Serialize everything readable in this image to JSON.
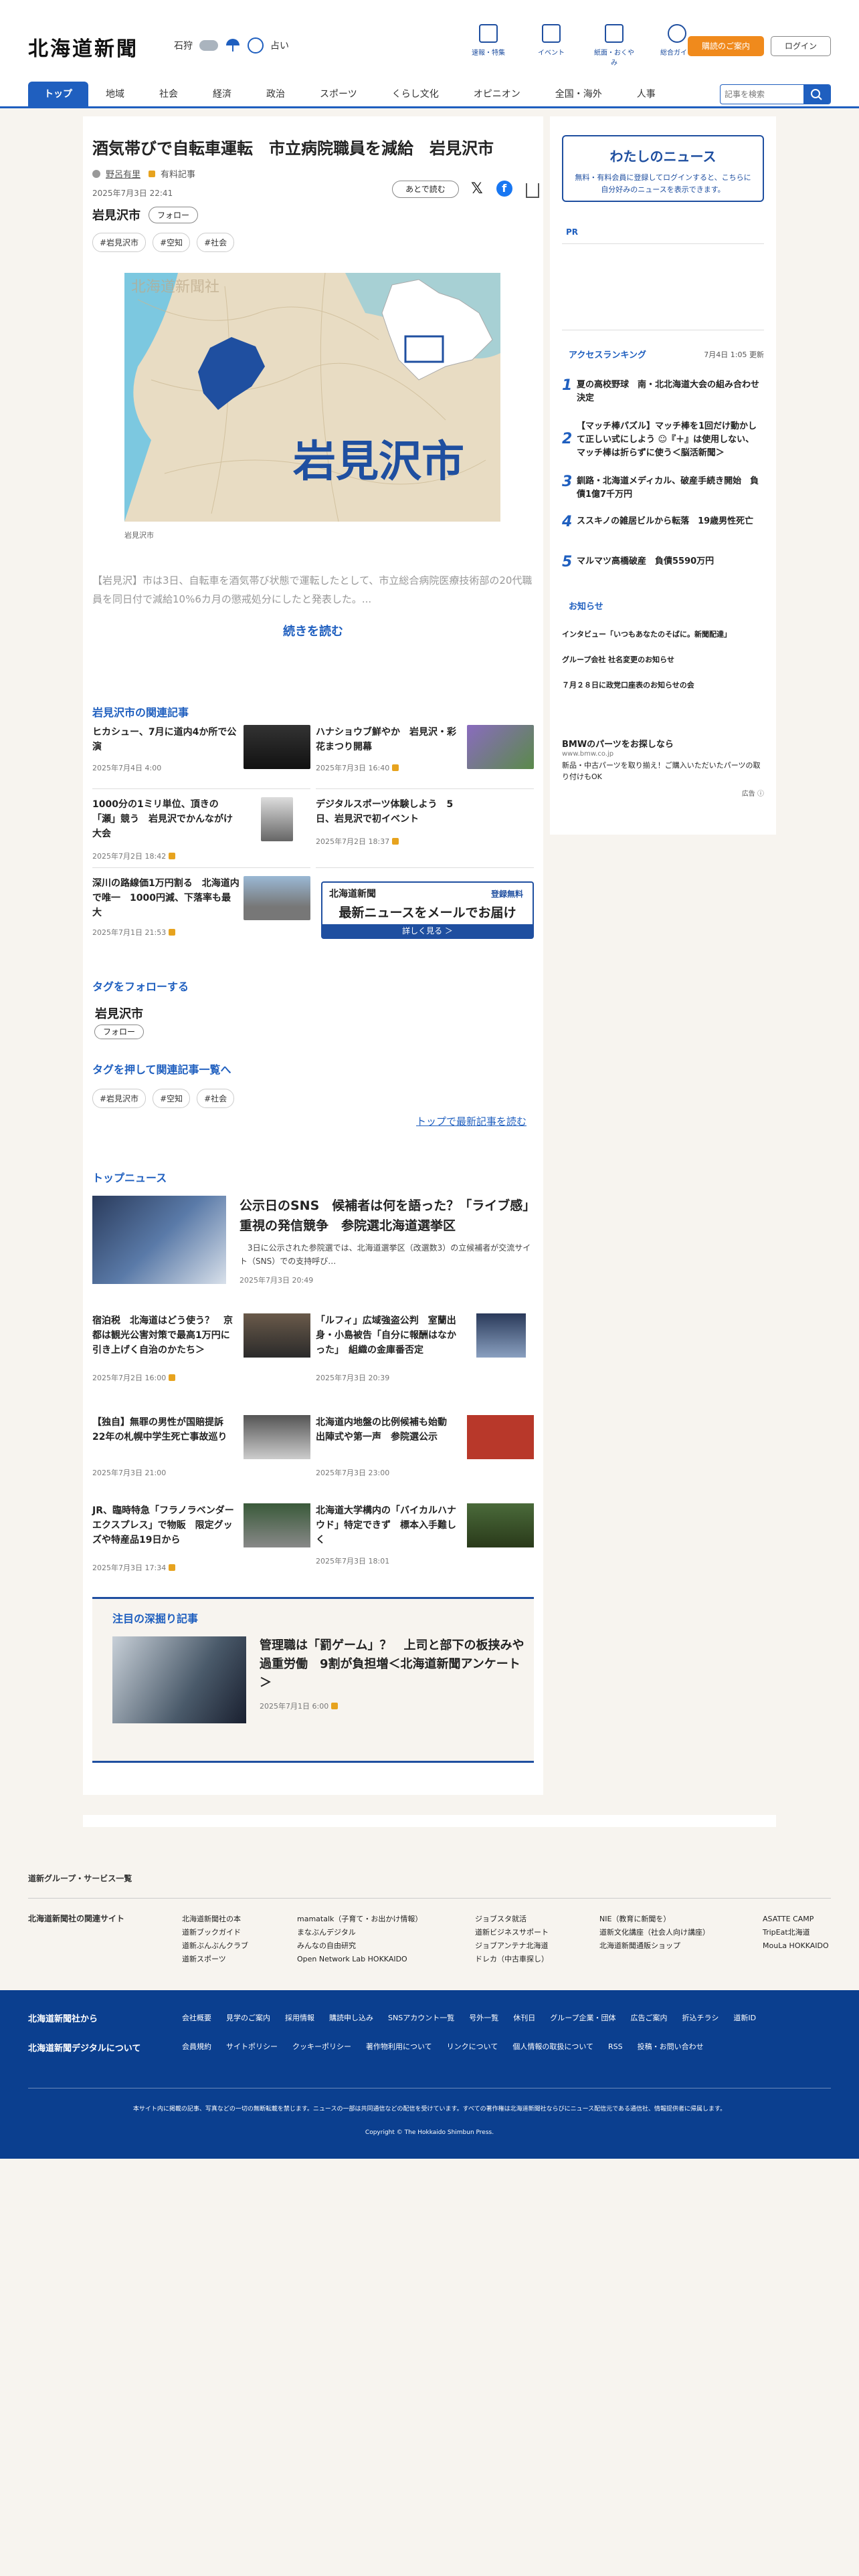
{
  "header": {
    "logo": "北海道新聞",
    "weather_city": "石狩",
    "weather_label": "占い",
    "icons": [
      {
        "label": "速報・特集",
        "icon": "flag-icon"
      },
      {
        "label": "イベント",
        "icon": "calendar-icon"
      },
      {
        "label": "紙面・おくやみ",
        "icon": "newspaper-icon"
      },
      {
        "label": "総合ガイド",
        "icon": "help-icon"
      }
    ],
    "subscribe": "購読のご案内",
    "login": "ログイン"
  },
  "nav": {
    "items": [
      "トップ",
      "地域",
      "社会",
      "経済",
      "政治",
      "スポーツ",
      "くらし文化",
      "オピニオン",
      "全国・海外",
      "人事"
    ],
    "search_placeholder": "記事を検索"
  },
  "article": {
    "title": "酒気帯びで自転車運転　市立病院職員を減給　岩見沢市",
    "author": "野呂有里",
    "paper": "有料記事",
    "date": "2025年7月3日 22:41",
    "read_later": "あとで読む",
    "tag_name": "岩見沢市",
    "follow": "フォロー",
    "tags": [
      "#岩見沢市",
      "#空知",
      "#社会"
    ],
    "image_watermark": "北海道新聞社",
    "image_city": "岩見沢市",
    "caption": "岩見沢市",
    "lead": "【岩見沢】市は3日、自転車を酒気帯び状態で運転したとして、市立総合病院医療技術部の20代職員を同日付で減給10%6カ月の懲戒処分にしたと発表した。...",
    "more": "続きを読む"
  },
  "related": {
    "heading": "岩見沢市の関連記事",
    "items": [
      {
        "title": "ヒカシュー、7月に道内4か所で公演",
        "date": "2025年7月4日 4:00",
        "lock": false
      },
      {
        "title": "ハナショウブ鮮やか　岩見沢・彩花まつり開幕",
        "date": "2025年7月3日 16:40",
        "lock": true
      },
      {
        "title": "1000分の1ミリ単位、頂きの「瀬」競う　岩見沢でかんながけ大会",
        "date": "2025年7月2日 18:42",
        "lock": true
      },
      {
        "title": "デジタルスポーツ体験しよう　5日、岩見沢で初イベント",
        "date": "2025年7月2日 18:37",
        "lock": true
      },
      {
        "title": "深川の路線価1万円割る　北海道内で唯一　1000円減、下落率も最大",
        "date": "2025年7月1日 21:53",
        "lock": true
      }
    ],
    "ad": {
      "logo": "北海道新聞",
      "badge": "登録無料",
      "main": "最新ニュースをメールでお届け",
      "sub": "詳しく見る ＞"
    }
  },
  "tagfollow": {
    "heading": "タグをフォローする",
    "tag": "岩見沢市",
    "follow": "フォロー",
    "heading2": "タグを押して関連記事一覧へ",
    "tags": [
      "#岩見沢市",
      "#空知",
      "#社会"
    ],
    "latest_link": "トップで最新記事を読む"
  },
  "top": {
    "heading": "トップニュース",
    "lead": {
      "title": "公示日のSNS　候補者は何を語った？「ライブ感」重視の発信競争　参院選北海道選挙区",
      "body": "　3日に公示された参院選では、北海道選挙区（改選数3）の立候補者が交流サイト（SNS）での支持呼び…",
      "date": "2025年7月3日 20:49"
    },
    "items": [
      {
        "title": "宿泊税　北海道はどう使う？　京都は観光公害対策で最高1万円に引き上げく自治のかたち＞",
        "date": "2025年7月2日 16:00",
        "lock": true
      },
      {
        "title": "「ルフィ」広域強盗公判　室蘭出身・小島被告「自分に報酬はなかった」　組織の金庫番否定",
        "date": "2025年7月3日 20:39",
        "lock": false
      },
      {
        "title": "【独自】無罪の男性が国賠提訴　22年の札幌中学生死亡事故巡り",
        "date": "2025年7月3日 21:00",
        "lock": false
      },
      {
        "title": "北海道内地盤の比例候補も始動　出陣式や第一声　参院選公示",
        "date": "2025年7月3日 23:00",
        "lock": false
      },
      {
        "title": "JR、臨時特急「フラノラベンダーエクスプレス」で物販　限定グッズや特産品19日から",
        "date": "2025年7月3日 17:34",
        "lock": true
      },
      {
        "title": "北海道大学構内の「バイカルハナウド」特定できず　標本入手難しく",
        "date": "2025年7月3日 18:01",
        "lock": false
      }
    ]
  },
  "deep": {
    "heading": "注目の深掘り記事",
    "title": "管理職は「罰ゲーム」？　上司と部下の板挟みや過重労働　9割が負担増＜北海道新聞アンケート＞",
    "date": "2025年7月1日 6:00"
  },
  "sidebar": {
    "mynews_title": "わたしのニュース",
    "mynews_text": "無料・有料会員に登録してログインすると、こちらに自分好みのニュースを表示できます。",
    "mynews_link": "ログイン",
    "pr": "PR",
    "ranking_heading": "アクセスランキング",
    "ranking_updated": "7月4日 1:05 更新",
    "ranking": [
      {
        "n": "1",
        "t": "夏の高校野球　南・北北海道大会の組み合わせ決定"
      },
      {
        "n": "2",
        "t": "【マッチ棒パズル】マッチ棒を1回だけ動かして正しい式にしよう ☺『＋』は使用しない、マッチ棒は折らずに使う＜脳活新聞＞"
      },
      {
        "n": "3",
        "t": "釧路・北海道メディカル、破産手続き開始　負債1億7千万円"
      },
      {
        "n": "4",
        "t": "ススキノの雑居ビルから転落　19歳男性死亡"
      },
      {
        "n": "5",
        "t": "マルマツ高橋破産　負債5590万円"
      }
    ],
    "notice_heading": "お知らせ",
    "notices": [
      "インタビュー「いつもあなたのそばに。新聞配達」",
      "グループ会社 社名変更のお知らせ",
      "７月２８日に政党口座表のお知らせの会"
    ],
    "ad_title": "BMWのパーツをお探しなら",
    "ad_url": "www.bmw.co.jp",
    "ad_text": "新品・中古パーツを取り揃え！ご購入いただいたパーツの取り付けもOK",
    "ad_label": "広告 ⓘ"
  },
  "footer": {
    "group_heading": "道新グループ・サービス一覧",
    "related_label": "北海道新聞社の関連サイト",
    "cols": [
      [
        "北海道新聞社の本",
        "道新ブックガイド",
        "道新ぶんぶんクラブ",
        "道新スポーツ"
      ],
      [
        "mamatalk（子育て・お出かけ情報）",
        "まなぶんデジタル",
        "みんなの自由研究",
        "Open Network Lab HOKKAIDO"
      ],
      [
        "ジョブスタ就活",
        "道新ビジネスサポート",
        "ジョブアンテナ北海道",
        "ドレカ（中古車探し）"
      ],
      [
        "NIE（教育に新聞を）",
        "道新文化講座（社会人向け講座）",
        "北海道新聞通販ショップ"
      ],
      [
        "ASATTE CAMP",
        "TripEat北海道",
        "MouLa HOKKAIDO"
      ]
    ],
    "from_label": "北海道新聞社から",
    "digital_label": "北海道新聞デジタルについて",
    "row1": [
      "会社概要",
      "見学のご案内",
      "採用情報",
      "購読申し込み",
      "SNSアカウント一覧",
      "号外一覧",
      "休刊日",
      "グループ企業・団体",
      "広告ご案内",
      "折込チラシ",
      "道新ID"
    ],
    "row2": [
      "会員規約",
      "サイトポリシー",
      "クッキーポリシー",
      "著作物利用について",
      "リンクについて",
      "個人情報の取扱について",
      "RSS",
      "投稿・お問い合わせ"
    ],
    "notice": "本サイト内に掲載の記事、写真などの一切の無断転載を禁じます。ニュースの一部は共同通信などの配信を受けています。すべての著作権は北海道新聞社ならびにニュース配信元である通信社、情報提供者に帰属します。",
    "copyright": "Copyright © The Hokkaido Shimbun Press."
  },
  "colors": {
    "brand_blue": "#1f5fbf",
    "orange": "#f08a1c",
    "footer_blue": "#0b3f8f"
  }
}
